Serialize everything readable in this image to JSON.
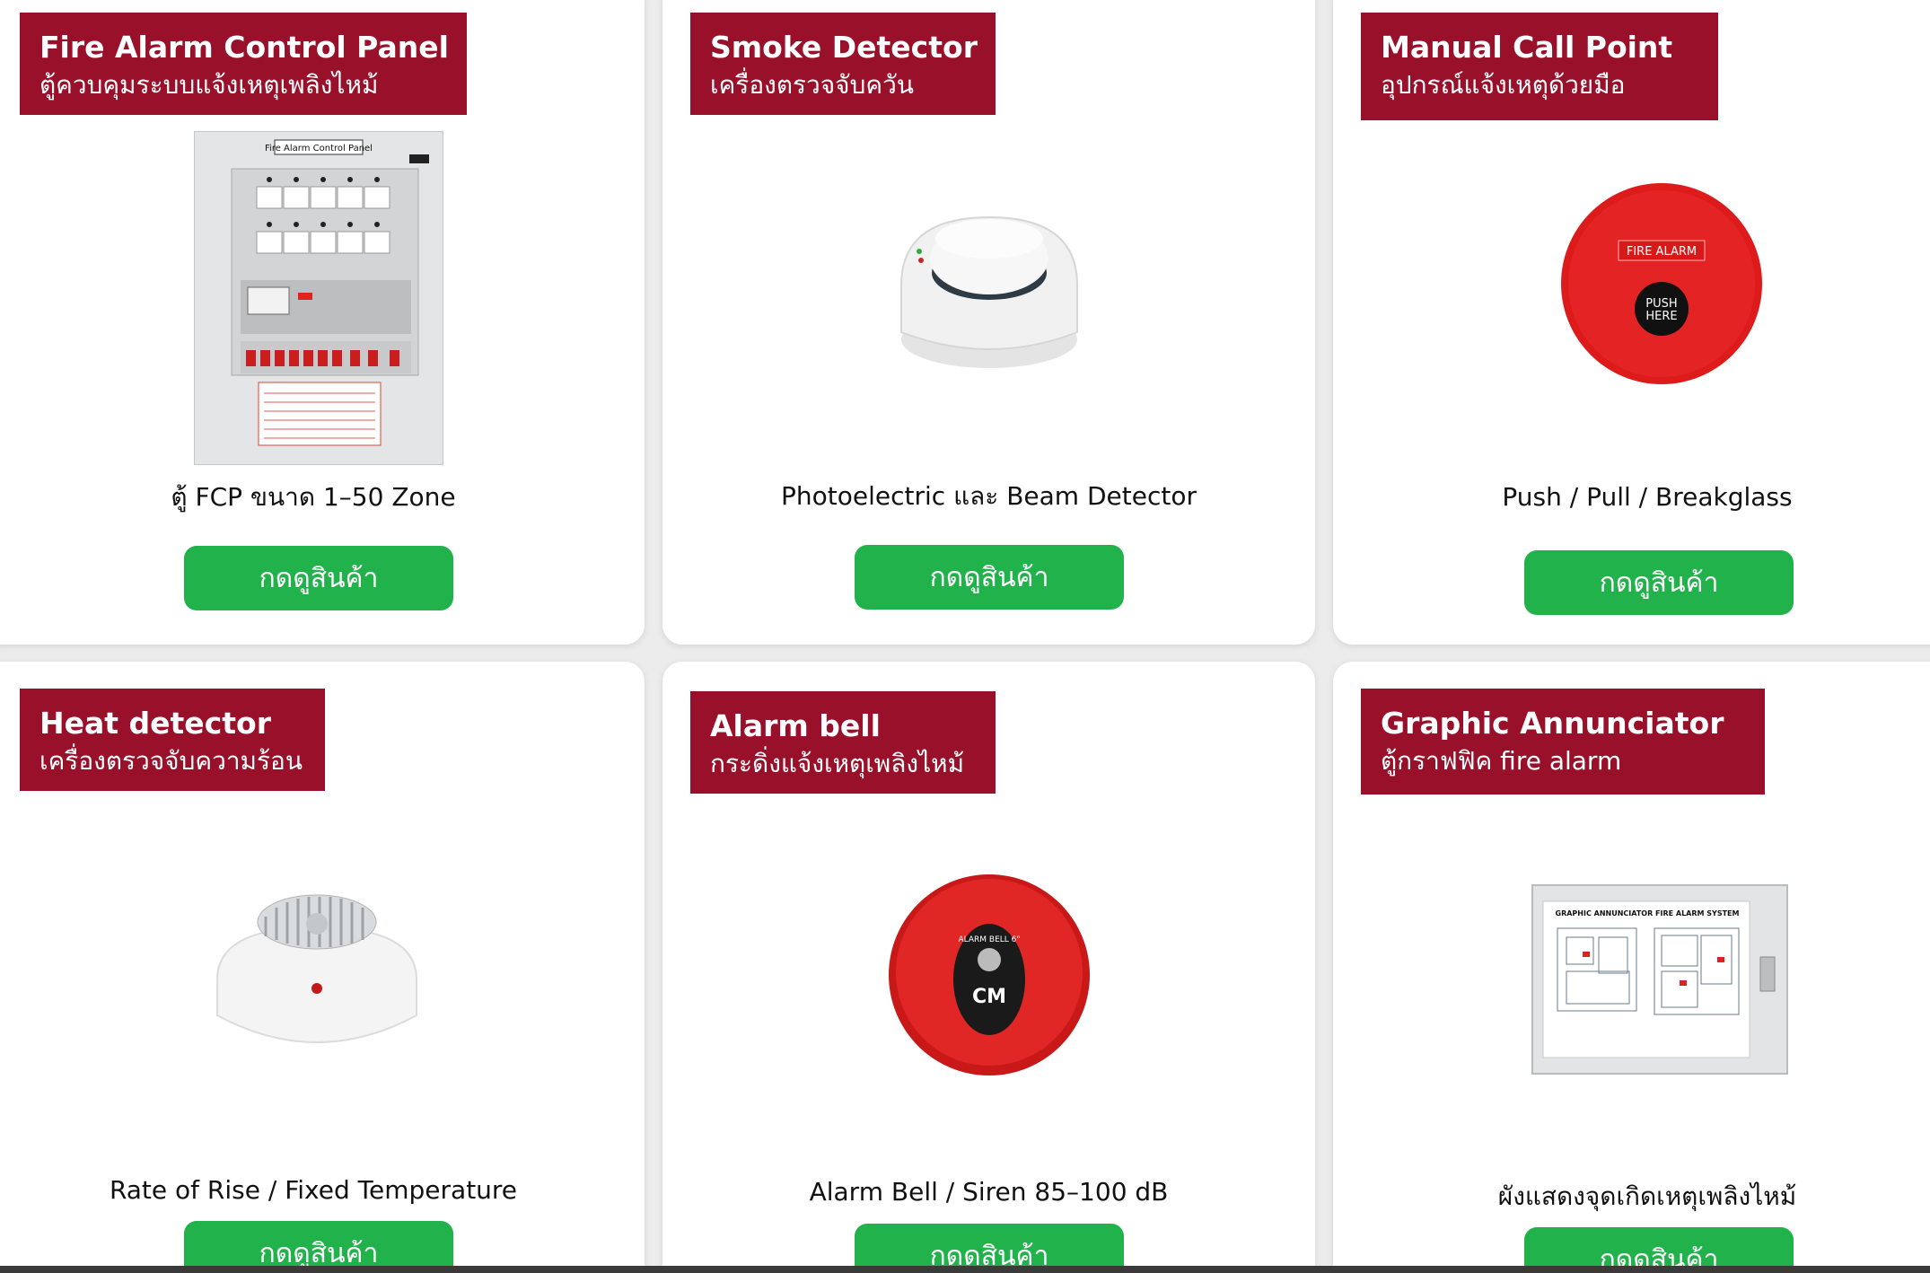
{
  "colors": {
    "label_background": "#98102a",
    "button_background": "#22b24c",
    "page_background": "#ececec",
    "card_background": "#ffffff"
  },
  "products": [
    {
      "title": "Fire Alarm Control Panel",
      "subtitle": "ตู้ควบคุมระบบแจ้งเหตุเพลิงไหม้",
      "description": "ตู้ FCP ขนาด 1–50 Zone",
      "button_label": "กดดูสินค้า",
      "image_icon": "fire-alarm-control-panel-image",
      "image_text": "Fire Alarm Control Panel"
    },
    {
      "title": "Smoke Detector",
      "subtitle": "เครื่องตรวจจับควัน",
      "description": "Photoelectric และ Beam Detector",
      "button_label": "กดดูสินค้า",
      "image_icon": "smoke-detector-image"
    },
    {
      "title": "Manual Call Point",
      "subtitle": "อุปกรณ์แจ้งเหตุด้วยมือ",
      "description": "Push / Pull / Breakglass",
      "button_label": "กดดูสินค้า",
      "image_icon": "manual-call-point-image",
      "image_text_top": "FIRE ALARM",
      "image_text_line1": "PUSH",
      "image_text_line2": "HERE"
    },
    {
      "title": "Heat detector",
      "subtitle": "เครื่องตรวจจับความร้อน",
      "description": "Rate of Rise / Fixed Temperature",
      "button_label": "กดดูสินค้า",
      "image_icon": "heat-detector-image"
    },
    {
      "title": "Alarm bell",
      "subtitle": "กระดิ่งแจ้งเหตุเพลิงไหม้",
      "description": "Alarm Bell / Siren 85–100 dB",
      "button_label": "กดดูสินค้า",
      "image_icon": "alarm-bell-image",
      "image_text": "ALARM BELL 6\"",
      "image_brand": "CM"
    },
    {
      "title": "Graphic Annunciator",
      "subtitle": "ตู้กราฟฟิค fire alarm",
      "description": "ผังแสดงจุดเกิดเหตุเพลิงไหม้",
      "button_label": "กดดูสินค้า",
      "image_icon": "graphic-annunciator-image",
      "image_text": "GRAPHIC ANNUNCIATOR FIRE ALARM SYSTEM"
    }
  ]
}
